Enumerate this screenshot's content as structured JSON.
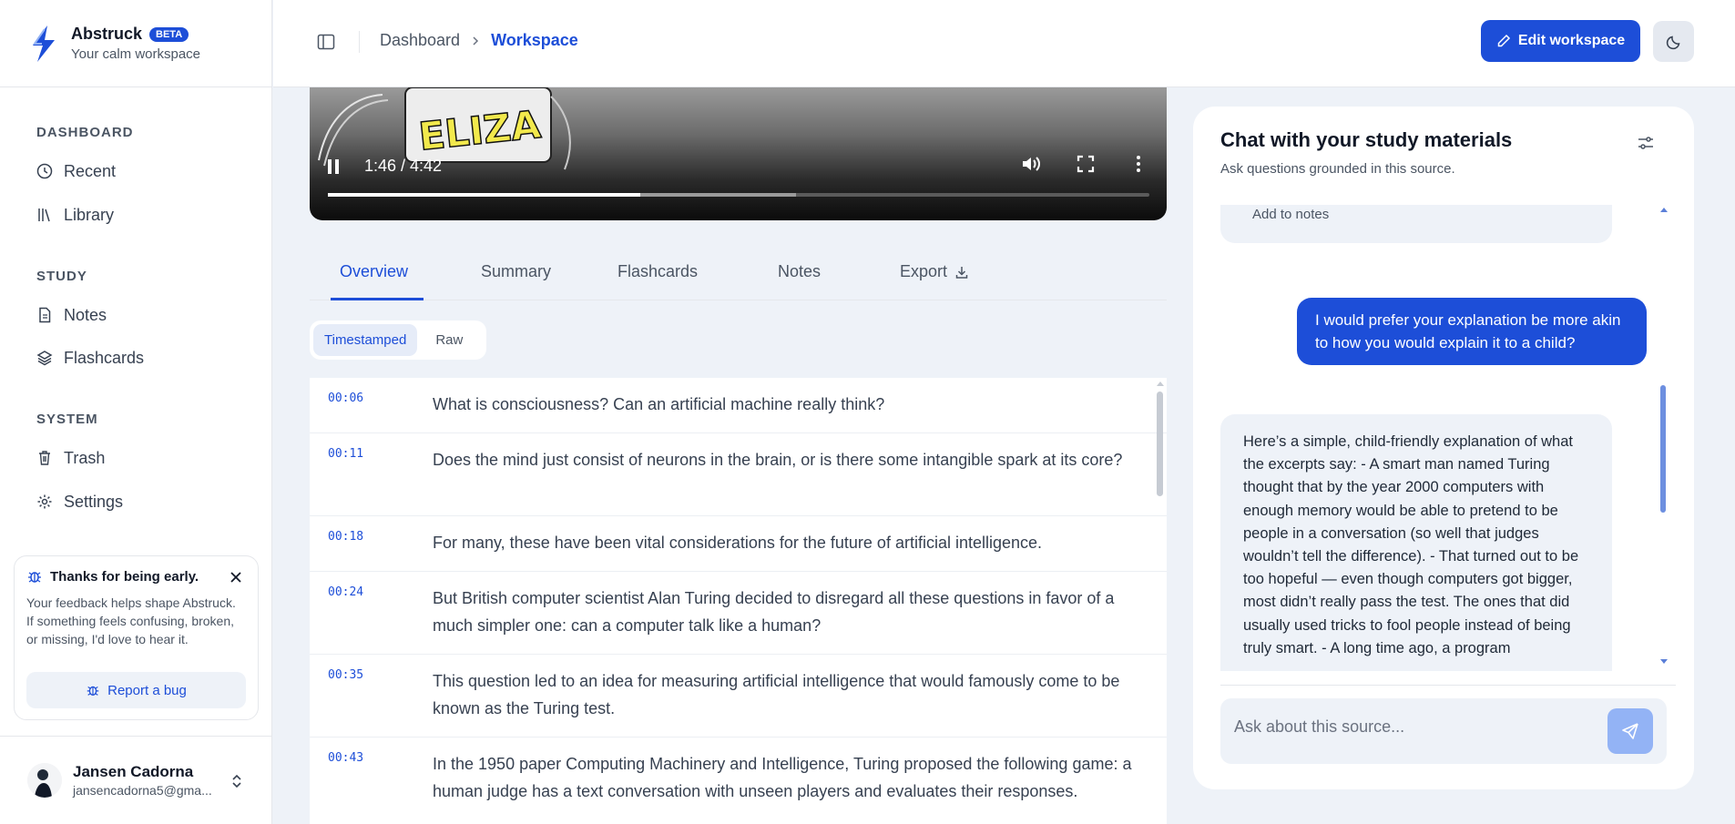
{
  "brand": {
    "name": "Abstruck",
    "badge": "BETA",
    "tagline": "Your calm workspace"
  },
  "sidebar": {
    "sections": [
      {
        "heading": "DASHBOARD",
        "items": [
          {
            "label": "Recent",
            "icon": "clock-icon"
          },
          {
            "label": "Library",
            "icon": "library-icon"
          }
        ]
      },
      {
        "heading": "STUDY",
        "items": [
          {
            "label": "Notes",
            "icon": "document-icon"
          },
          {
            "label": "Flashcards",
            "icon": "layers-icon"
          }
        ]
      },
      {
        "heading": "SYSTEM",
        "items": [
          {
            "label": "Trash",
            "icon": "trash-icon"
          },
          {
            "label": "Settings",
            "icon": "gear-icon"
          }
        ]
      }
    ],
    "feedback": {
      "title": "Thanks for being early.",
      "text": "Your feedback helps shape Abstruck. If something feels confusing, broken, or missing, I'd love to hear it.",
      "button": "Report a bug"
    },
    "user": {
      "name": "Jansen Cadorna",
      "email": "jansencadorna5@gma..."
    }
  },
  "header": {
    "breadcrumb": [
      "Dashboard",
      "Workspace"
    ],
    "edit_button": "Edit workspace"
  },
  "video": {
    "time": "1:46 / 4:42",
    "played_fraction": 0.38,
    "buffered_fraction": 0.57,
    "art_text": "ELIZA"
  },
  "tabs": [
    "Overview",
    "Summary",
    "Flashcards",
    "Notes",
    "Export"
  ],
  "active_tab": "Overview",
  "transcript_modes": [
    "Timestamped",
    "Raw"
  ],
  "transcript": [
    {
      "time": "00:06",
      "text": "What is consciousness? Can an artificial machine really think?"
    },
    {
      "time": "00:11",
      "text": "Does the mind just consist of neurons in the brain, or is there some intangible spark at its core?"
    },
    {
      "time": "00:18",
      "text": "For many, these have been vital considerations for the future of artificial intelligence."
    },
    {
      "time": "00:24",
      "text": "But British computer scientist Alan Turing decided to disregard all these questions in favor of a much simpler one: can a computer talk like a human?"
    },
    {
      "time": "00:35",
      "text": "This question led to an idea for measuring artificial intelligence that would famously come to be known as the Turing test."
    },
    {
      "time": "00:43",
      "text": "In the 1950 paper Computing Machinery and Intelligence, Turing proposed the following game: a human judge has a text conversation with unseen players and evaluates their responses."
    }
  ],
  "chat": {
    "title": "Chat with your study materials",
    "subtitle": "Ask questions grounded in this source.",
    "add_to_notes": "Add to notes",
    "user_message": "I would prefer your explanation be more akin to how you would explain it to a child?",
    "ai_message": "Here’s a simple, child-friendly explanation of what the excerpts say: - A smart man named Turing thought that by the year 2000 computers with enough memory would be able to pretend to be people in a conversation (so well that judges wouldn’t tell the difference). - That turned out to be too hopeful — even though computers got bigger, most didn’t really pass the test. The ones that did usually used tricks to fool people instead of being truly smart. - A long time ago, a program",
    "input_placeholder": "Ask about this source..."
  },
  "colors": {
    "accent": "#1d4ed8",
    "background": "#eef2f8"
  }
}
